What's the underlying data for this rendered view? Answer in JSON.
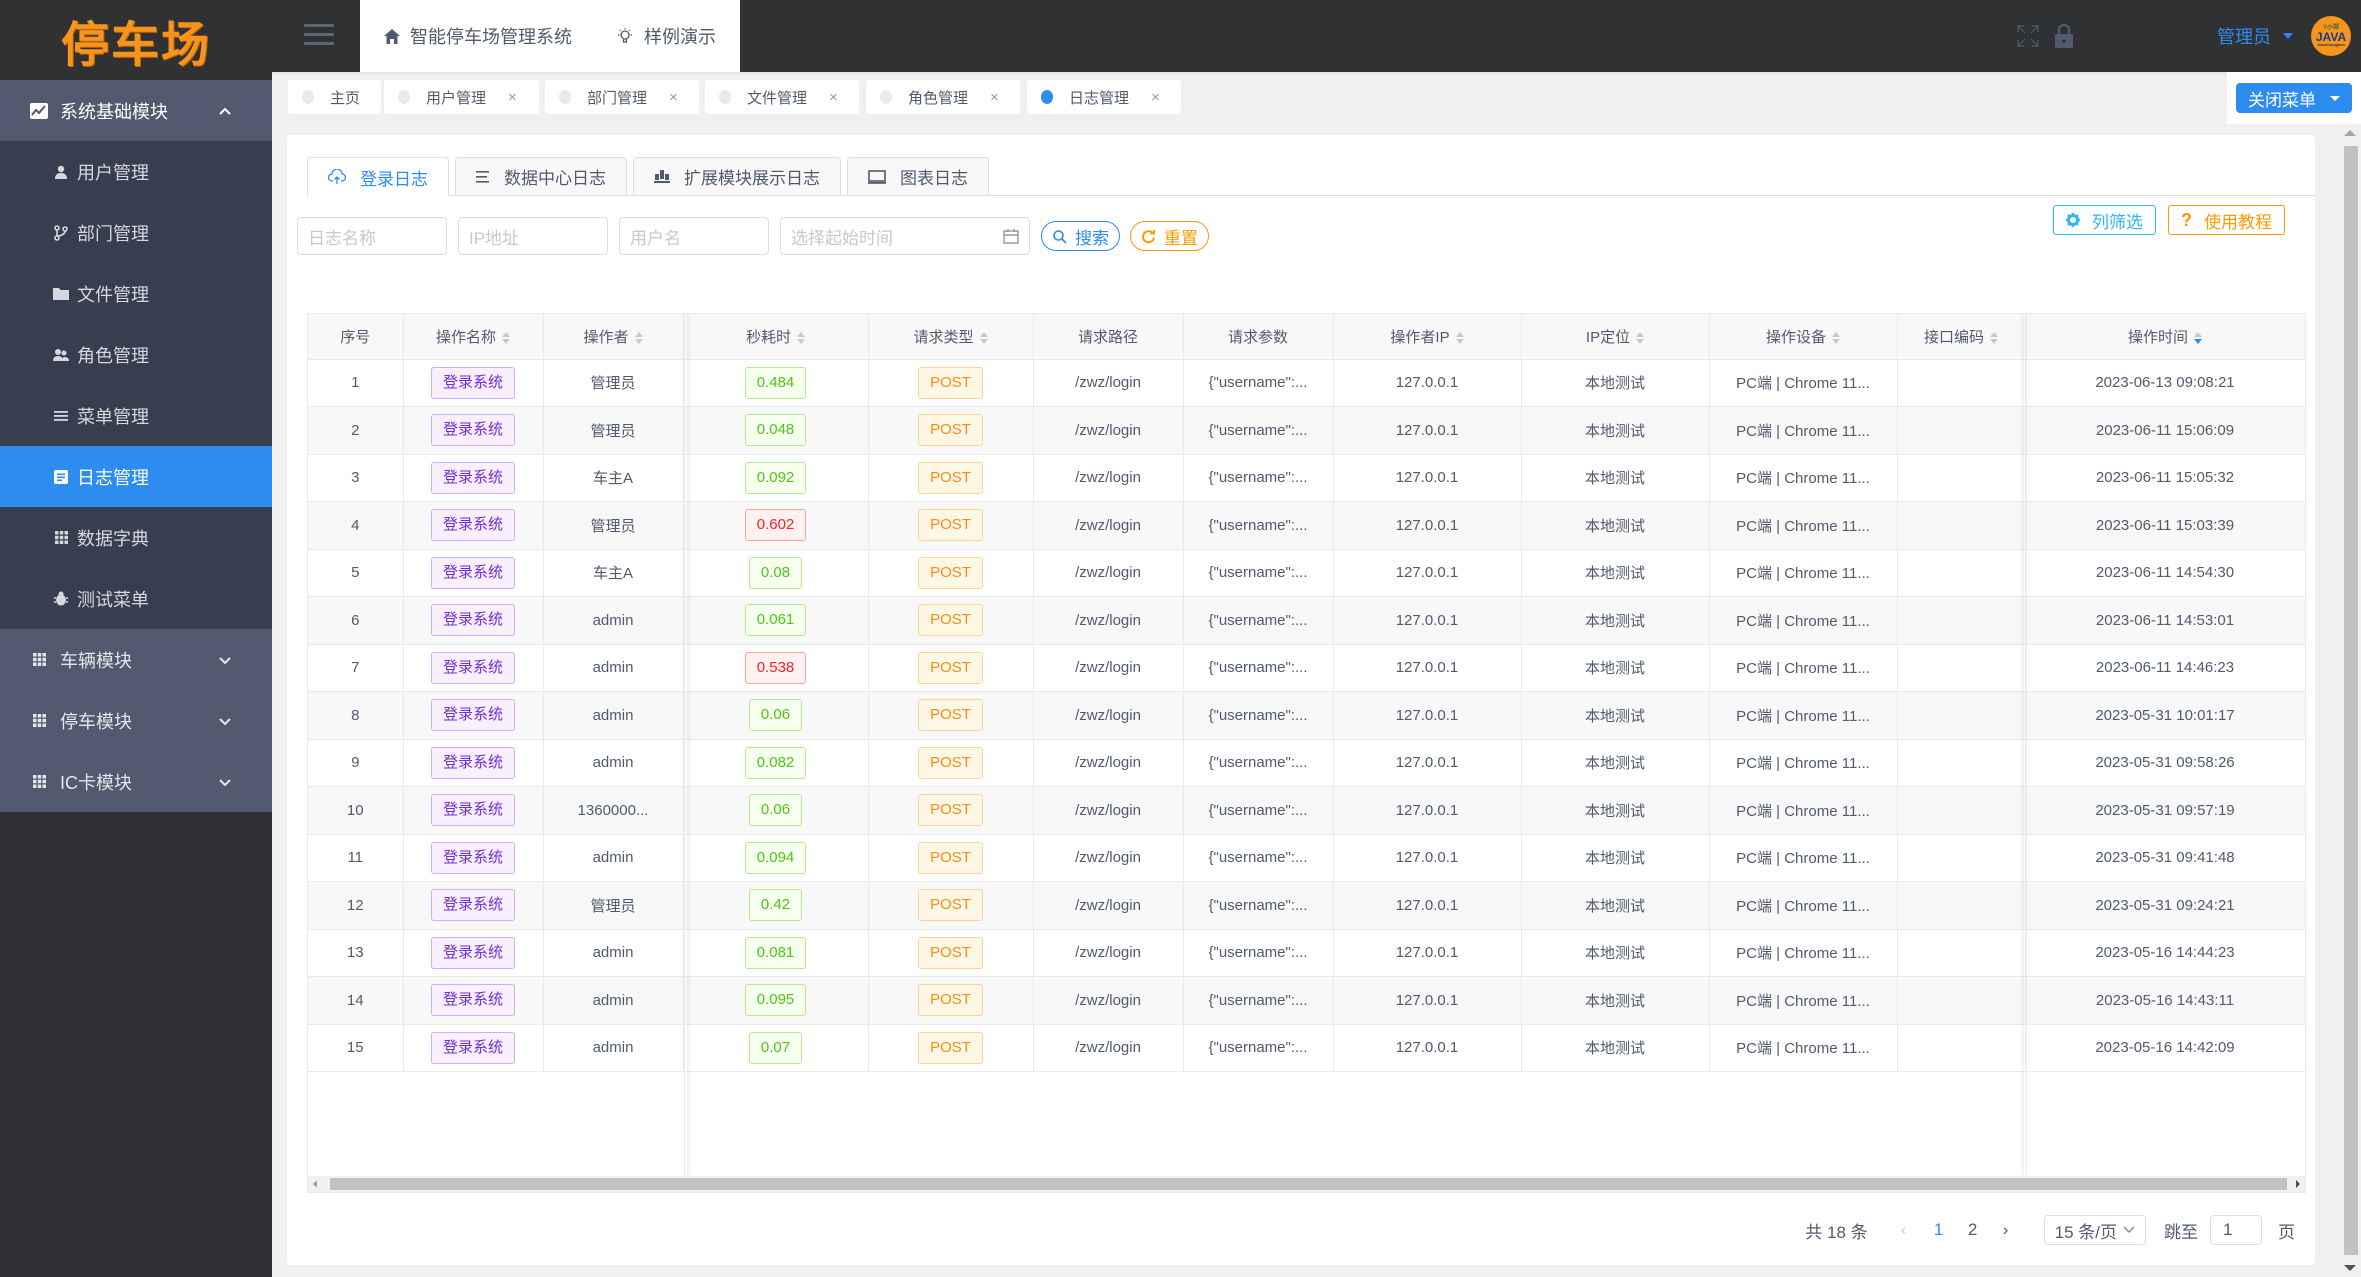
{
  "logo": {
    "text": "停车场"
  },
  "header": {
    "nav": [
      {
        "label": "智能停车场管理系统",
        "icon": "home-icon"
      },
      {
        "label": "样例演示",
        "icon": "bulb-icon"
      }
    ],
    "user_name": "管理员",
    "avatar": {
      "top": "Y小郑",
      "main": "JAVA",
      "bottom": "xiaozhengjava"
    }
  },
  "sidebar": {
    "groups": [
      {
        "label": "系统基础模块",
        "expanded": true,
        "items": [
          {
            "label": "用户管理",
            "icon": "user-icon"
          },
          {
            "label": "部门管理",
            "icon": "branch-icon"
          },
          {
            "label": "文件管理",
            "icon": "folder-icon"
          },
          {
            "label": "角色管理",
            "icon": "people-icon"
          },
          {
            "label": "菜单管理",
            "icon": "menu-icon"
          },
          {
            "label": "日志管理",
            "icon": "document-icon",
            "active": true
          },
          {
            "label": "数据字典",
            "icon": "grid-icon"
          },
          {
            "label": "测试菜单",
            "icon": "bug-icon"
          }
        ]
      },
      {
        "label": "车辆模块",
        "expanded": false
      },
      {
        "label": "停车模块",
        "expanded": false
      },
      {
        "label": "IC卡模块",
        "expanded": false
      }
    ]
  },
  "tagbar": {
    "tags": [
      {
        "label": "主页",
        "closable": false
      },
      {
        "label": "用户管理",
        "closable": true
      },
      {
        "label": "部门管理",
        "closable": true
      },
      {
        "label": "文件管理",
        "closable": true
      },
      {
        "label": "角色管理",
        "closable": true
      },
      {
        "label": "日志管理",
        "closable": true,
        "active": true
      }
    ],
    "close_icon": "×",
    "close_menu_label": "关闭菜单"
  },
  "log_tabs": [
    {
      "label": "登录日志",
      "active": true
    },
    {
      "label": "数据中心日志"
    },
    {
      "label": "扩展模块展示日志"
    },
    {
      "label": "图表日志"
    }
  ],
  "filters": {
    "log_name_placeholder": "日志名称",
    "ip_placeholder": "IP地址",
    "username_placeholder": "用户名",
    "date_placeholder": "选择起始时间",
    "search_label": "搜索",
    "reset_label": "重置"
  },
  "tools": {
    "columns_label": "列筛选",
    "help_label": "使用教程",
    "help_glyph": "?"
  },
  "table": {
    "columns": [
      "序号",
      "操作名称",
      "操作者",
      "秒耗时",
      "请求类型",
      "请求路径",
      "请求参数",
      "操作者IP",
      "IP定位",
      "操作设备",
      "接口编码",
      "操作时间"
    ],
    "rows": [
      {
        "no": "1",
        "name": "登录系统",
        "user": "管理员",
        "cost": "0.484",
        "cost_level": "green",
        "method": "POST",
        "path": "/zwz/login",
        "params": "{\"username\":...",
        "ip": "127.0.0.1",
        "loc": "本地测试",
        "device": "PC端 | Chrome 11...",
        "code": "",
        "time": "2023-06-13 09:08:21"
      },
      {
        "no": "2",
        "name": "登录系统",
        "user": "管理员",
        "cost": "0.048",
        "cost_level": "green",
        "method": "POST",
        "path": "/zwz/login",
        "params": "{\"username\":...",
        "ip": "127.0.0.1",
        "loc": "本地测试",
        "device": "PC端 | Chrome 11...",
        "code": "",
        "time": "2023-06-11 15:06:09"
      },
      {
        "no": "3",
        "name": "登录系统",
        "user": "车主A",
        "cost": "0.092",
        "cost_level": "green",
        "method": "POST",
        "path": "/zwz/login",
        "params": "{\"username\":...",
        "ip": "127.0.0.1",
        "loc": "本地测试",
        "device": "PC端 | Chrome 11...",
        "code": "",
        "time": "2023-06-11 15:05:32"
      },
      {
        "no": "4",
        "name": "登录系统",
        "user": "管理员",
        "cost": "0.602",
        "cost_level": "red",
        "method": "POST",
        "path": "/zwz/login",
        "params": "{\"username\":...",
        "ip": "127.0.0.1",
        "loc": "本地测试",
        "device": "PC端 | Chrome 11...",
        "code": "",
        "time": "2023-06-11 15:03:39"
      },
      {
        "no": "5",
        "name": "登录系统",
        "user": "车主A",
        "cost": "0.08",
        "cost_level": "green",
        "method": "POST",
        "path": "/zwz/login",
        "params": "{\"username\":...",
        "ip": "127.0.0.1",
        "loc": "本地测试",
        "device": "PC端 | Chrome 11...",
        "code": "",
        "time": "2023-06-11 14:54:30"
      },
      {
        "no": "6",
        "name": "登录系统",
        "user": "admin",
        "cost": "0.061",
        "cost_level": "green",
        "method": "POST",
        "path": "/zwz/login",
        "params": "{\"username\":...",
        "ip": "127.0.0.1",
        "loc": "本地测试",
        "device": "PC端 | Chrome 11...",
        "code": "",
        "time": "2023-06-11 14:53:01"
      },
      {
        "no": "7",
        "name": "登录系统",
        "user": "admin",
        "cost": "0.538",
        "cost_level": "red",
        "method": "POST",
        "path": "/zwz/login",
        "params": "{\"username\":...",
        "ip": "127.0.0.1",
        "loc": "本地测试",
        "device": "PC端 | Chrome 11...",
        "code": "",
        "time": "2023-06-11 14:46:23"
      },
      {
        "no": "8",
        "name": "登录系统",
        "user": "admin",
        "cost": "0.06",
        "cost_level": "green",
        "method": "POST",
        "path": "/zwz/login",
        "params": "{\"username\":...",
        "ip": "127.0.0.1",
        "loc": "本地测试",
        "device": "PC端 | Chrome 11...",
        "code": "",
        "time": "2023-05-31 10:01:17"
      },
      {
        "no": "9",
        "name": "登录系统",
        "user": "admin",
        "cost": "0.082",
        "cost_level": "green",
        "method": "POST",
        "path": "/zwz/login",
        "params": "{\"username\":...",
        "ip": "127.0.0.1",
        "loc": "本地测试",
        "device": "PC端 | Chrome 11...",
        "code": "",
        "time": "2023-05-31 09:58:26"
      },
      {
        "no": "10",
        "name": "登录系统",
        "user": "1360000...",
        "cost": "0.06",
        "cost_level": "green",
        "method": "POST",
        "path": "/zwz/login",
        "params": "{\"username\":...",
        "ip": "127.0.0.1",
        "loc": "本地测试",
        "device": "PC端 | Chrome 11...",
        "code": "",
        "time": "2023-05-31 09:57:19"
      },
      {
        "no": "11",
        "name": "登录系统",
        "user": "admin",
        "cost": "0.094",
        "cost_level": "green",
        "method": "POST",
        "path": "/zwz/login",
        "params": "{\"username\":...",
        "ip": "127.0.0.1",
        "loc": "本地测试",
        "device": "PC端 | Chrome 11...",
        "code": "",
        "time": "2023-05-31 09:41:48"
      },
      {
        "no": "12",
        "name": "登录系统",
        "user": "管理员",
        "cost": "0.42",
        "cost_level": "green",
        "method": "POST",
        "path": "/zwz/login",
        "params": "{\"username\":...",
        "ip": "127.0.0.1",
        "loc": "本地测试",
        "device": "PC端 | Chrome 11...",
        "code": "",
        "time": "2023-05-31 09:24:21"
      },
      {
        "no": "13",
        "name": "登录系统",
        "user": "admin",
        "cost": "0.081",
        "cost_level": "green",
        "method": "POST",
        "path": "/zwz/login",
        "params": "{\"username\":...",
        "ip": "127.0.0.1",
        "loc": "本地测试",
        "device": "PC端 | Chrome 11...",
        "code": "",
        "time": "2023-05-16 14:44:23"
      },
      {
        "no": "14",
        "name": "登录系统",
        "user": "admin",
        "cost": "0.095",
        "cost_level": "green",
        "method": "POST",
        "path": "/zwz/login",
        "params": "{\"username\":...",
        "ip": "127.0.0.1",
        "loc": "本地测试",
        "device": "PC端 | Chrome 11...",
        "code": "",
        "time": "2023-05-16 14:43:11"
      },
      {
        "no": "15",
        "name": "登录系统",
        "user": "admin",
        "cost": "0.07",
        "cost_level": "green",
        "method": "POST",
        "path": "/zwz/login",
        "params": "{\"username\":...",
        "ip": "127.0.0.1",
        "loc": "本地测试",
        "device": "PC端 | Chrome 11...",
        "code": "",
        "time": "2023-05-16 14:42:09"
      }
    ]
  },
  "pagination": {
    "total_label": "共 18 条",
    "pages": [
      "1",
      "2"
    ],
    "current_page": "1",
    "prev": "‹",
    "next": "›",
    "page_size_label": "15 条/页",
    "jump_label": "跳至",
    "jump_value": "1",
    "page_suffix": "页"
  },
  "colors": {
    "primary": "#2d8cf0",
    "warning": "#ff9900",
    "info": "#2db7f5",
    "sidebar_group": "#515a6e",
    "sidebar_sub": "#363e4f",
    "header": "#303133",
    "logo": "#f7941d"
  }
}
